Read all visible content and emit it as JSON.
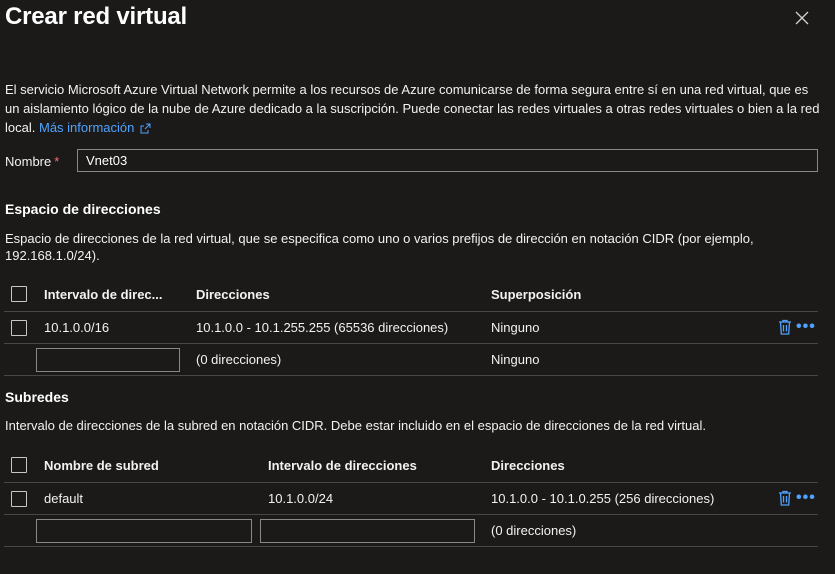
{
  "panel": {
    "title": "Crear red virtual",
    "description": "El servicio Microsoft Azure Virtual Network permite a los recursos de Azure comunicarse de forma segura entre sí en una red virtual, que es un aislamiento lógico de la nube de Azure dedicado a la suscripción. Puede conectar las redes virtuales a otras redes virtuales o bien a la red local.",
    "more_link": "Más información"
  },
  "name": {
    "label": "Nombre",
    "required_mark": "*",
    "value": "Vnet03"
  },
  "address_space": {
    "heading": "Espacio de direcciones",
    "description": "Espacio de direcciones de la red virtual, que se especifica como uno o varios prefijos de dirección en notación CIDR (por ejemplo, 192.168.1.0/24).",
    "columns": [
      "Intervalo de direc...",
      "Direcciones",
      "Superposición"
    ],
    "rows": [
      {
        "range": "10.1.0.0/16",
        "addresses": "10.1.0.0 - 10.1.255.255 (65536 direcciones)",
        "overlap": "Ninguno"
      }
    ],
    "new_row": {
      "addresses": "(0 direcciones)",
      "overlap": "Ninguno"
    }
  },
  "subnets": {
    "heading": "Subredes",
    "description": "Intervalo de direcciones de la subred en notación CIDR. Debe estar incluido en el espacio de direcciones de la red virtual.",
    "columns": [
      "Nombre de subred",
      "Intervalo de direcciones",
      "Direcciones"
    ],
    "rows": [
      {
        "name": "default",
        "range": "10.1.0.0/24",
        "addresses": "10.1.0.0 - 10.1.0.255 (256 direcciones)"
      }
    ],
    "new_row": {
      "addresses": "(0 direcciones)"
    }
  },
  "icons": {
    "close": "close-icon",
    "delete": "trash-icon",
    "more": "more-icon",
    "external": "external-link-icon"
  },
  "colors": {
    "background": "#1b1a19",
    "accent": "#4fa3ff",
    "required": "#f1707b"
  }
}
